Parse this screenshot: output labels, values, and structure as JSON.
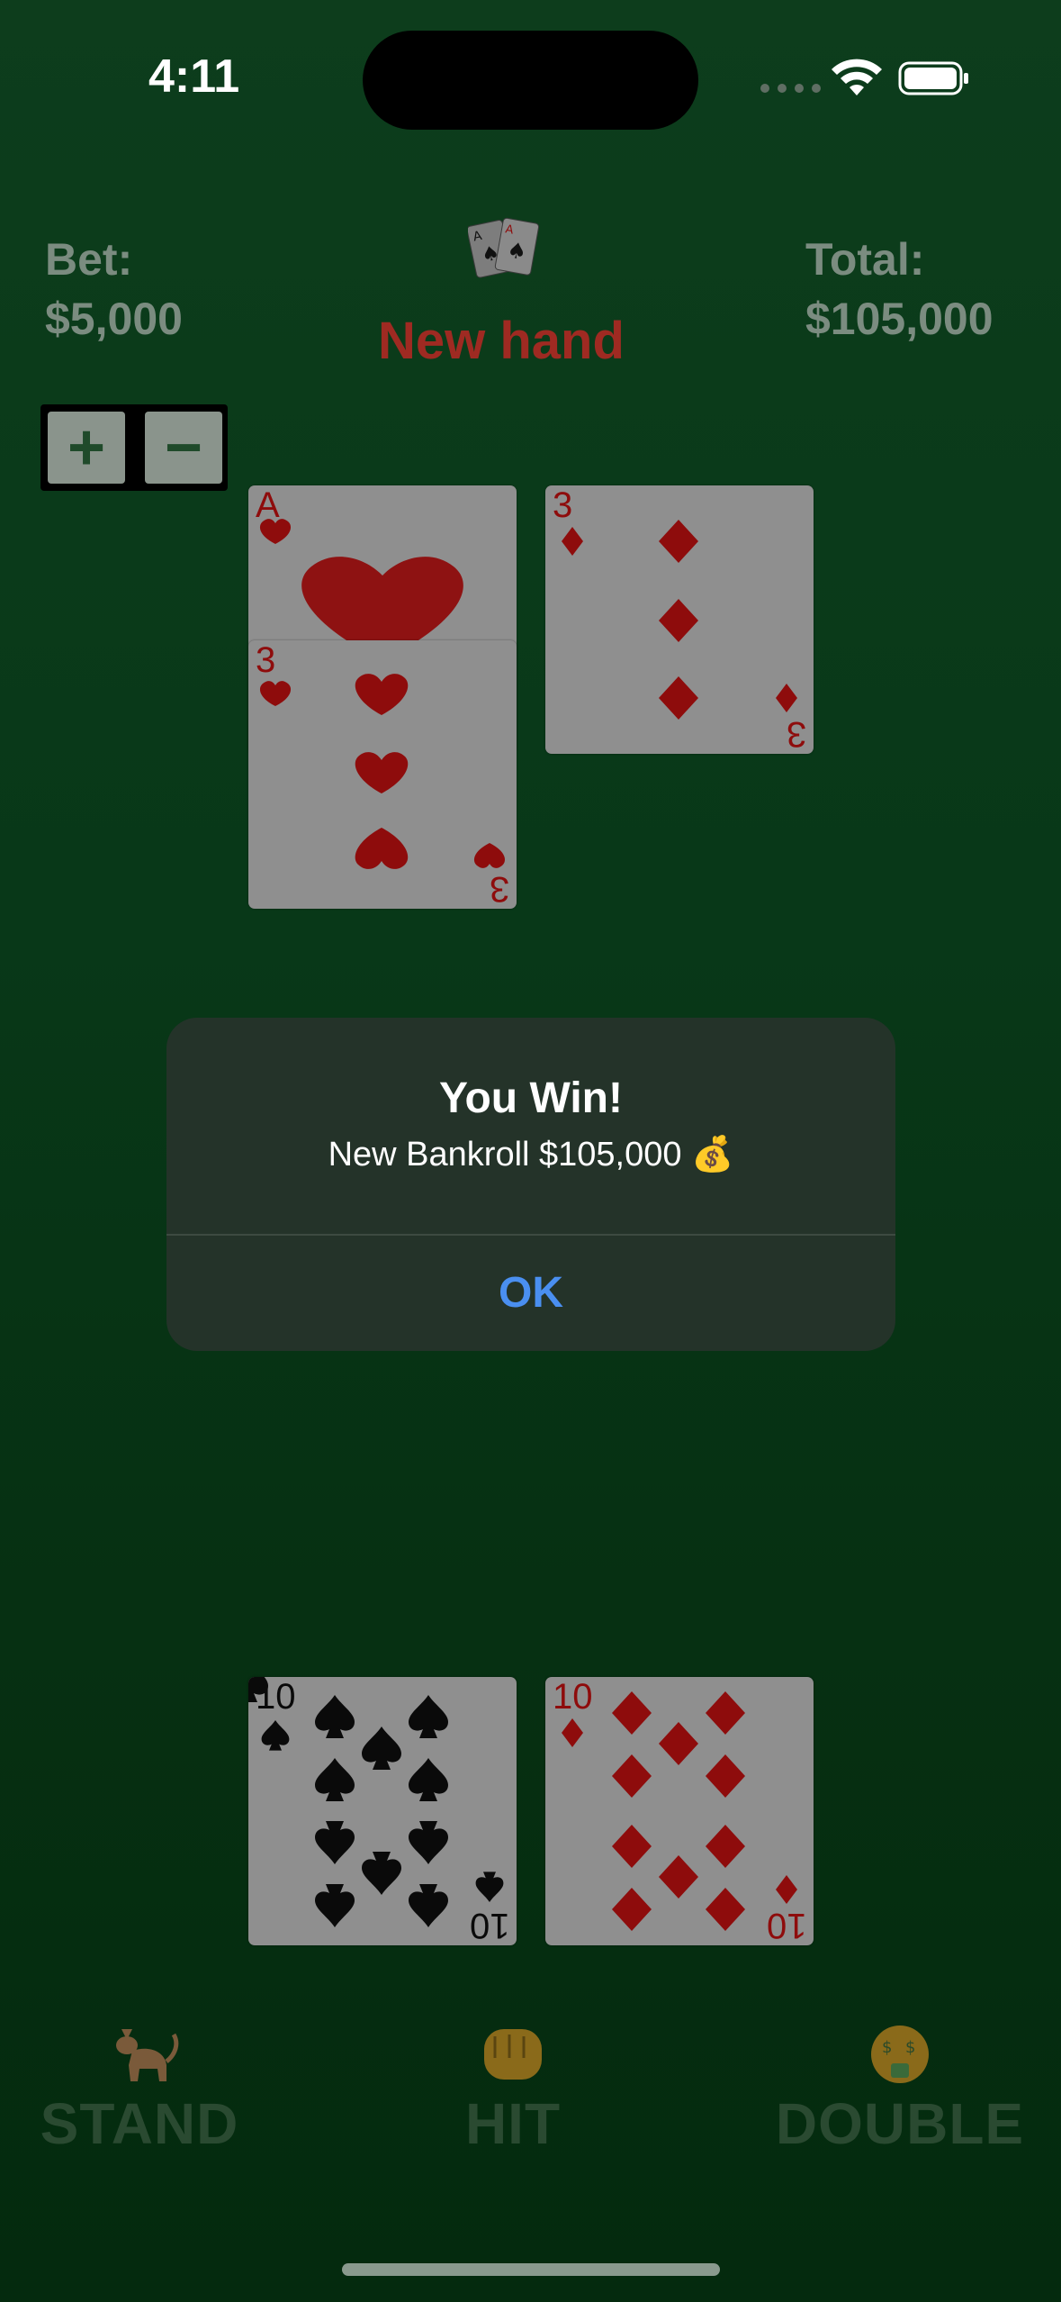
{
  "status_bar": {
    "time": "4:11"
  },
  "header": {
    "bet_label": "Bet:",
    "bet_value": "$5,000",
    "total_label": "Total:",
    "total_value": "$105,000",
    "title": "New hand"
  },
  "stepper": {
    "plus": "+",
    "minus": "−"
  },
  "dealer_cards": [
    {
      "rank": "A",
      "suit": "hearts"
    },
    {
      "rank": "3",
      "suit": "hearts"
    },
    {
      "rank": "3",
      "suit": "diamonds"
    }
  ],
  "player_cards": [
    {
      "rank": "10",
      "suit": "spades"
    },
    {
      "rank": "10",
      "suit": "diamonds"
    }
  ],
  "alert": {
    "title": "You Win!",
    "message": "New Bankroll $105,000 💰",
    "ok": "OK"
  },
  "actions": [
    {
      "emoji": "🐈",
      "label": "STAND"
    },
    {
      "emoji": "👊",
      "label": "HIT"
    },
    {
      "emoji": "🤑",
      "label": "DOUBLE"
    }
  ],
  "colors": {
    "felt": "#083818",
    "title_red": "#9f2a22",
    "card_red": "#8e0c0c",
    "alert_bg": "#243329",
    "ok_blue": "#4a8ff0"
  }
}
